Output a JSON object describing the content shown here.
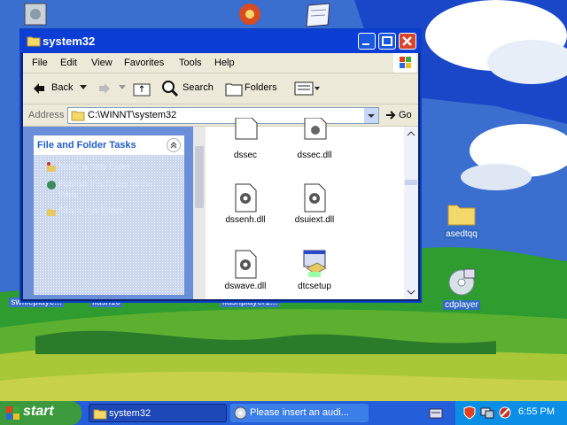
{
  "window": {
    "title": "system32",
    "menu": [
      "File",
      "Edit",
      "View",
      "Favorites",
      "Tools",
      "Help"
    ],
    "toolbar": {
      "back": "Back",
      "search": "Search",
      "folders": "Folders"
    },
    "address": {
      "label": "Address",
      "value": "C:\\WINNT\\system32",
      "go": "Go"
    },
    "tasks": {
      "title": "File and Folder Tasks",
      "items": [
        "Make a new folder",
        "Publish this folder to the Web",
        "Share this folder"
      ]
    },
    "files": [
      {
        "name": "dssec",
        "icon": "document-icon"
      },
      {
        "name": "dssec.dll",
        "icon": "dll-gear-icon"
      },
      {
        "name": "dssenh.dll",
        "icon": "dll-gear-icon"
      },
      {
        "name": "dsuiext.dll",
        "icon": "dll-gear-icon"
      },
      {
        "name": "dswave.dll",
        "icon": "dll-gear-icon"
      },
      {
        "name": "dtcsetup",
        "icon": "setup-icon"
      }
    ]
  },
  "desktop_icons": [
    {
      "label": "swflieplaye...",
      "icon": "flash-icon"
    },
    {
      "label": "flash10",
      "icon": "flash-icon"
    },
    {
      "label": "flashplayer1...",
      "icon": "flash-icon"
    },
    {
      "label": "asedtqq",
      "icon": "folder-icon"
    },
    {
      "label": "cdplayer",
      "icon": "cd-icon"
    }
  ],
  "taskbar": {
    "start": "start",
    "buttons": [
      {
        "label": "system32",
        "icon": "folder-icon"
      },
      {
        "label": "Please insert an audi...",
        "icon": "cd-icon"
      }
    ],
    "clock": "6:55 PM"
  },
  "colors": {
    "titlebar": "#0c3ed6",
    "taskbar": "#245ed8",
    "start": "#3c9a3c",
    "tray": "#0b8fe6"
  }
}
